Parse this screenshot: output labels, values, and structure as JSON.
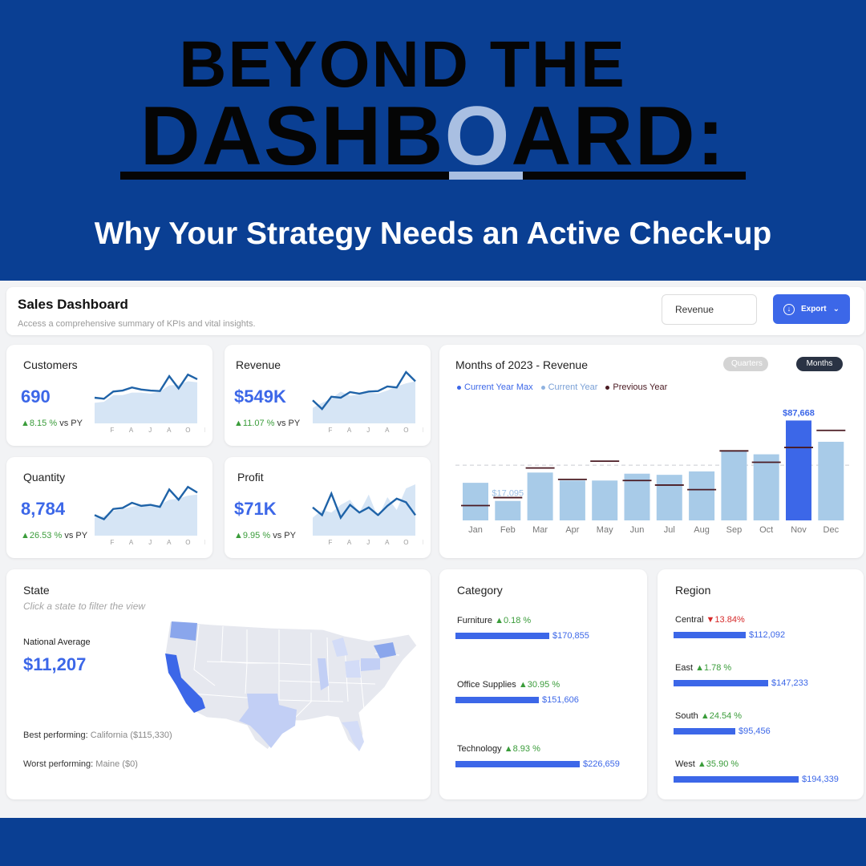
{
  "hero": {
    "line1": "BEYOND THE",
    "line2_before": "DASHB",
    "line2_highlight": "O",
    "line2_after": "ARD:",
    "subtitle": "Why Your Strategy Needs an Active Check-up"
  },
  "header": {
    "title": "Sales Dashboard",
    "subtitle": "Access a comprehensive summary of KPIs and vital insights.",
    "select_value": "Revenue",
    "export_label": "Export"
  },
  "kpis": {
    "customers": {
      "title": "Customers",
      "value": "690",
      "delta": "▲8.15 %",
      "vs": " vs PY"
    },
    "revenue": {
      "title": "Revenue",
      "value": "$549K",
      "delta": "▲11.07 %",
      "vs": " vs PY"
    },
    "quantity": {
      "title": "Quantity",
      "value": "8,784",
      "delta": "▲26.53 %",
      "vs": " vs PY"
    },
    "profit": {
      "title": "Profit",
      "value": "$71K",
      "delta": "▲9.95 %",
      "vs": " vs PY"
    }
  },
  "spark_months": [
    "F",
    "A",
    "J",
    "A",
    "O",
    "D"
  ],
  "months": {
    "title": "Months of 2023 - Revenue",
    "pill_quarters": "Quarters",
    "pill_months": "Months",
    "legend": [
      {
        "label": "Current Year Max",
        "color": "#3c67e8"
      },
      {
        "label": "Current Year",
        "color": "#8fb2e0"
      },
      {
        "label": "Previous Year",
        "color": "#4a1a22"
      }
    ],
    "max_label": "$87,668",
    "min_label": "$17,095"
  },
  "state": {
    "title": "State",
    "hint": "Click a state to filter the view",
    "national_label": "National Average",
    "national_value": "$11,207",
    "best_label": "Best performing:",
    "best_value": " California ($115,330)",
    "worst_label": "Worst performing:",
    "worst_value": " Maine ($0)"
  },
  "category": {
    "title": "Category",
    "items": [
      {
        "name": "Furniture",
        "delta": "▲0.18 %",
        "dir": "up",
        "value": "$170,855",
        "amount": 170855
      },
      {
        "name": "Office Supplies",
        "delta": "▲30.95 %",
        "dir": "up",
        "value": "$151,606",
        "amount": 151606
      },
      {
        "name": "Technology",
        "delta": "▲8.93 %",
        "dir": "up",
        "value": "$226,659",
        "amount": 226659
      }
    ]
  },
  "region": {
    "title": "Region",
    "items": [
      {
        "name": "Central",
        "delta": "▼13.84%",
        "dir": "down",
        "value": "$112,092",
        "amount": 112092
      },
      {
        "name": "East",
        "delta": "▲1.78 %",
        "dir": "up",
        "value": "$147,233",
        "amount": 147233
      },
      {
        "name": "South",
        "delta": "▲24.54 %",
        "dir": "up",
        "value": "$95,456",
        "amount": 95456
      },
      {
        "name": "West",
        "delta": "▲35.90 %",
        "dir": "up",
        "value": "$194,339",
        "amount": 194339
      }
    ]
  },
  "chart_data": [
    {
      "type": "bar",
      "title": "Months of 2023 - Revenue",
      "categories": [
        "Jan",
        "Feb",
        "Mar",
        "Apr",
        "May",
        "Jun",
        "Jul",
        "Aug",
        "Sep",
        "Oct",
        "Nov",
        "Dec"
      ],
      "series": [
        {
          "name": "Current Year",
          "values": [
            33000,
            17095,
            42000,
            35000,
            35000,
            41000,
            40000,
            43000,
            61000,
            58000,
            87668,
            69000
          ]
        },
        {
          "name": "Previous Year",
          "values": [
            13000,
            20000,
            46000,
            36000,
            52000,
            35000,
            31000,
            27000,
            61000,
            51000,
            64000,
            79000
          ]
        }
      ],
      "ylim": [
        0,
        95000
      ],
      "average": 48500
    },
    {
      "type": "area",
      "title": "Customers",
      "x": [
        "F",
        "A",
        "J",
        "A",
        "O",
        "D"
      ],
      "series": [
        {
          "name": "Current Year",
          "values": [
            50,
            48,
            62,
            64,
            70,
            66,
            64,
            63,
            92,
            68,
            95,
            86
          ]
        },
        {
          "name": "Previous Year",
          "values": [
            40,
            42,
            55,
            55,
            60,
            60,
            58,
            62,
            74,
            75,
            82,
            80
          ]
        }
      ]
    },
    {
      "type": "area",
      "title": "Revenue",
      "x": [
        "F",
        "A",
        "J",
        "A",
        "O",
        "D"
      ],
      "series": [
        {
          "name": "Current Year",
          "values": [
            45,
            28,
            52,
            50,
            61,
            58,
            62,
            63,
            72,
            70,
            100,
            82
          ]
        },
        {
          "name": "Previous Year",
          "values": [
            30,
            40,
            48,
            62,
            54,
            56,
            60,
            58,
            64,
            72,
            78,
            82
          ]
        }
      ]
    },
    {
      "type": "area",
      "title": "Quantity",
      "x": [
        "F",
        "A",
        "J",
        "A",
        "O",
        "D"
      ],
      "series": [
        {
          "name": "Current Year",
          "values": [
            40,
            32,
            52,
            54,
            64,
            58,
            60,
            56,
            90,
            70,
            95,
            84
          ]
        },
        {
          "name": "Previous Year",
          "values": [
            35,
            38,
            48,
            52,
            56,
            60,
            58,
            60,
            70,
            72,
            78,
            80
          ]
        }
      ]
    },
    {
      "type": "area",
      "title": "Profit",
      "x": [
        "F",
        "A",
        "J",
        "A",
        "O",
        "D"
      ],
      "series": [
        {
          "name": "Current Year",
          "values": [
            55,
            40,
            82,
            35,
            60,
            45,
            55,
            40,
            58,
            72,
            65,
            40
          ]
        },
        {
          "name": "Previous Year",
          "values": [
            35,
            50,
            45,
            60,
            70,
            45,
            80,
            35,
            75,
            50,
            92,
            100
          ]
        }
      ]
    }
  ]
}
